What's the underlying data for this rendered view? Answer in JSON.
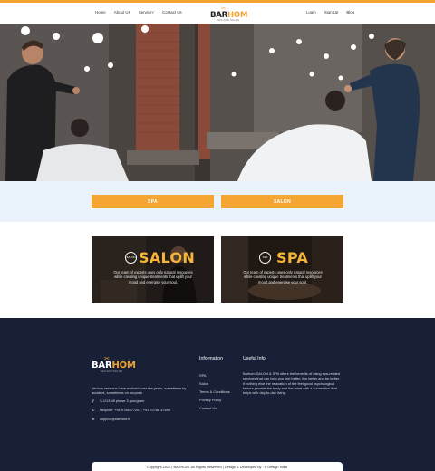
{
  "header": {
    "nav_left": [
      "Home",
      "About Us",
      "Service",
      "Contact Us"
    ],
    "service_chevron": "˅",
    "nav_right": [
      "Login",
      "Sign Up",
      "Blog"
    ],
    "logo_text_a": "BAR",
    "logo_text_b": "HOM",
    "logo_sub": "SPA AND SALON",
    "accent_color": "#f3a32f"
  },
  "categories": {
    "spa_label": "SPA",
    "salon_label": "SALON",
    "button_color": "#f5a531"
  },
  "cards": {
    "salon": {
      "icon_text": "SALON",
      "title": "SALON",
      "text": "Our team of experts uses only natural resources while creating unique treatments that uplift your mood and energise your soul."
    },
    "spa": {
      "icon_text": "SPA",
      "title": "SPA",
      "text": "Our team of experts uses only natural resources while creating unique treatments that uplift your mood and energise your soul."
    }
  },
  "footer": {
    "logo_text_a": "BAR",
    "logo_text_b": "HOM",
    "logo_sub": "SPA AND SALON",
    "about": "Various versions have evolved over the years, sometimes by accident, sometimes on purpose.",
    "address": "S-1/13 dlf phase 3 gurugram",
    "helpline": "Helpline: +91 9758377267, +91 70788 47696",
    "email": "support@barhom.in",
    "information_heading": "Information",
    "useful_heading": "Useful Info",
    "links": [
      "SPA",
      "Salon",
      "Terms & Conditions",
      "Privacy Policy",
      "Contact Us"
    ],
    "useful_text": "Barhom SALON & SPA offers the benefits of using spa-related services that can help you feel better, live better and be better. If nothing else the relaxation of the feel-good psychological factors provide the body and the mind with a connection that helps with day-to-day living.",
    "copyright": "Copyright 2022 | BARHOM. All Rights Reserved | Design & Developed by : K Design India",
    "background_color": "#172036"
  }
}
